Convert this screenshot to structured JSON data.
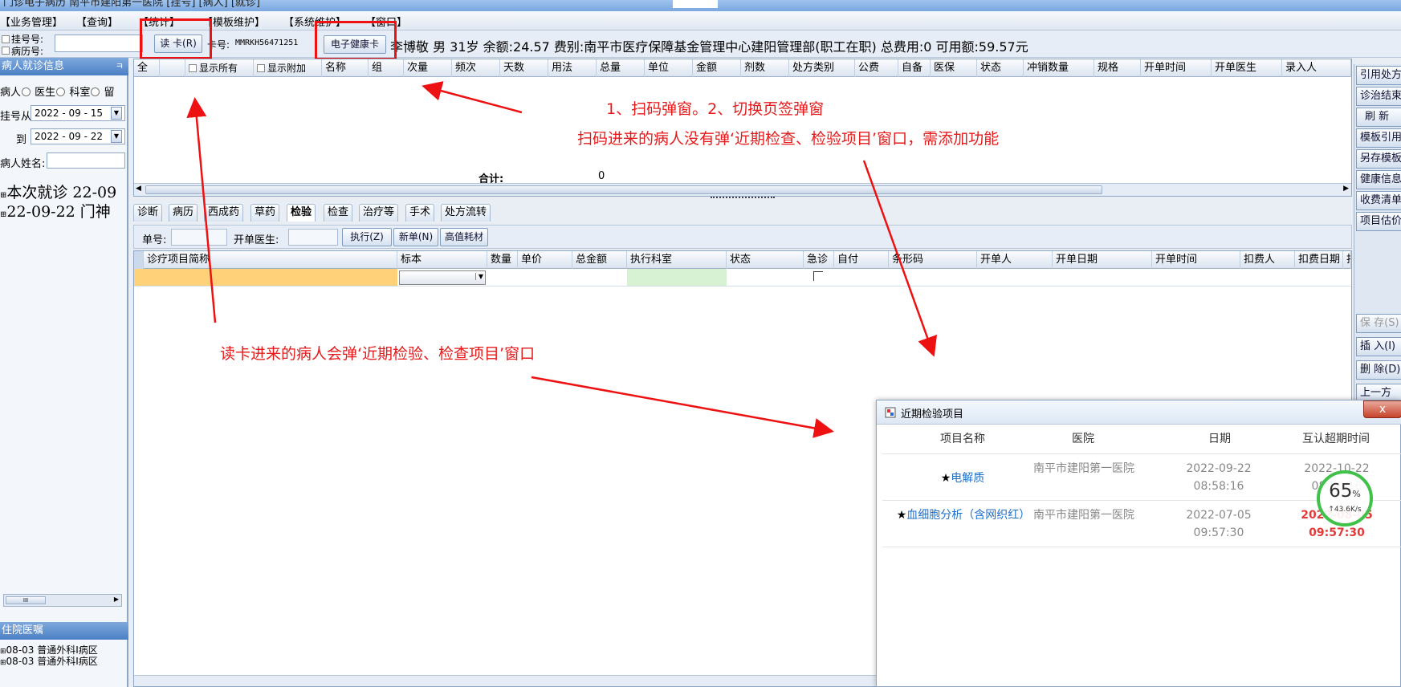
{
  "titlebar": {
    "text": "门诊电子病历 南平市建阳第一医院 [挂号] [病人] [就诊]"
  },
  "menu": [
    "【业务管理】",
    "【查询】",
    "【统计】",
    "【模板维护】",
    "【系统维护】",
    "【窗口】"
  ],
  "toolbar": {
    "reg_no_label": "挂号号:",
    "record_no_label": "病历号:",
    "read_card_button": "读 卡(R)",
    "card_no_label": "卡号:",
    "card_no_value": "MMRKH56471251",
    "health_card_button": "电子健康卡",
    "patient_info": "李博敬 男 31岁 余额:24.57 费别:南平市医疗保障基金管理中心建阳管理部(职工在职) 总费用:0 可用额:59.57元"
  },
  "left_panel": {
    "header": "病人就诊信息",
    "pin": "ㅋ",
    "radio_options": [
      "病人",
      "医生",
      "科室",
      "留"
    ],
    "reg_from_label": "挂号从",
    "reg_from_value": "2022 - 09 - 15",
    "to_label": "到",
    "to_value": "2022 - 09 - 22",
    "name_label": "病人姓名:",
    "tree_items": [
      "本次就诊 22-09",
      "22-09-22 门神"
    ],
    "bottom_header": "住院医嘱",
    "bottom_items": [
      "08-03 普通外科Ⅰ病区",
      "08-03 普通外科Ⅰ病区"
    ],
    "scroll_thumb": "III"
  },
  "main_grid": {
    "select_all": "全",
    "show_all": "显示所有",
    "show_extra": "显示附加",
    "columns": [
      "名称",
      "组",
      "次量",
      "频次",
      "天数",
      "用法",
      "总量",
      "单位",
      "金额",
      "剂数",
      "处方类别",
      "公费",
      "自备",
      "医保",
      "状态",
      "冲销数量",
      "规格",
      "开单时间",
      "开单医生",
      "录入人"
    ],
    "sum_label": "合计:",
    "sum_value": "0"
  },
  "tabs": [
    "诊断",
    "病历",
    "西成药",
    "草药",
    "检验",
    "检查",
    "治疗等",
    "手术",
    "处方流转"
  ],
  "active_tab": "检验",
  "sub_toolbar": {
    "order_no_label": "单号:",
    "doctor_label": "开单医生:",
    "execute_button": "执行(Z)",
    "new_button": "新单(N)",
    "high_value_button": "高值耗材"
  },
  "lab_grid": {
    "columns": [
      "诊疗项目简称",
      "标本",
      "数量",
      "单价",
      "总金额",
      "执行科室",
      "状态",
      "急诊",
      "自付",
      "条形码",
      "开单人",
      "开单日期",
      "开单时间",
      "扣费人",
      "扣费日期",
      "扣"
    ]
  },
  "right_buttons": [
    "引用处方",
    "诊治结束",
    "刷 新",
    "模板引用",
    "另存模板",
    "健康信息",
    "收费清单",
    "项目估价",
    "保 存(S)",
    "插 入(I)",
    "删 除(D)",
    "上一方"
  ],
  "popup": {
    "title": "近期检验项目",
    "close": "x",
    "columns": [
      "项目名称",
      "医院",
      "日期",
      "互认超期时间"
    ],
    "rows": [
      {
        "name": "电解质",
        "hospital": "南平市建阳第一医院",
        "date": "2022-09-22 08:58:16",
        "expire": "2022-10-22 08:58:16",
        "overdue": false
      },
      {
        "name": "血细胞分析（含网织红）",
        "hospital": "南平市建阳第一医院",
        "date": "2022-07-05 09:57:30",
        "expire": "2022-08-05 09:57:30",
        "overdue": true
      }
    ]
  },
  "speed_badge": {
    "percent": "65",
    "unit": "%",
    "rate": "↑43.6K/s"
  },
  "annotations": {
    "line1": "1、扫码弹窗。2、切换页签弹窗",
    "line2": "扫码进来的病人没有弹‘近期检查、检验项目’窗口，需添加功能",
    "line3": "读卡进来的病人会弹‘近期检验、检查项目’窗口"
  },
  "colors": {
    "annotation_red": "#e61a1a",
    "link_blue": "#1d6fc8",
    "overdue_red": "#e53a3a",
    "header_blue": "#4b7fc4"
  }
}
